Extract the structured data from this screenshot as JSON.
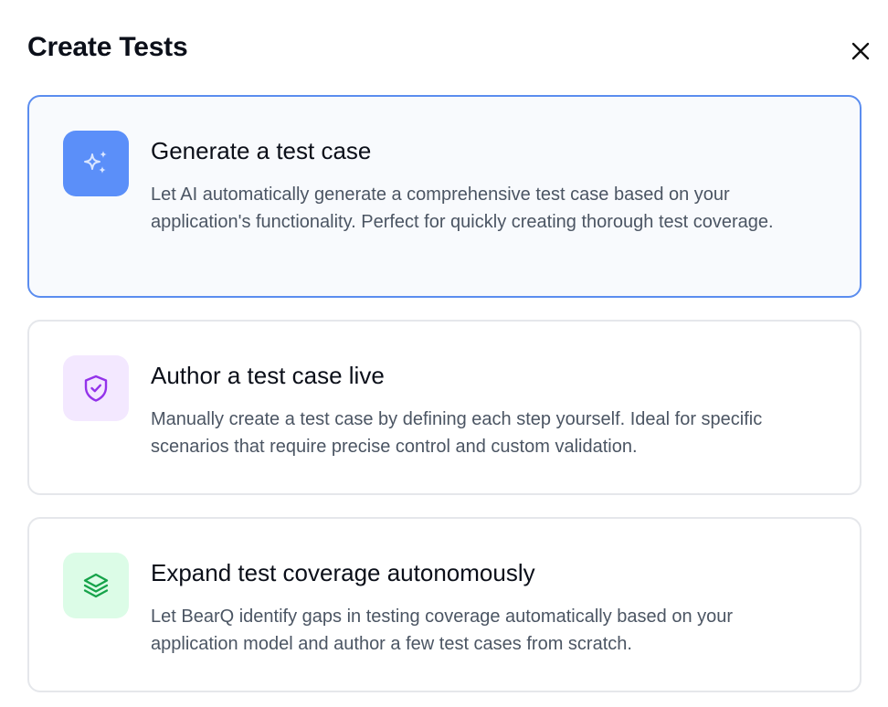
{
  "dialog": {
    "title": "Create Tests"
  },
  "options": [
    {
      "title": "Generate a test case",
      "description": "Let AI automatically generate a comprehensive test case based on your application's functionality. Perfect for quickly creating thorough test coverage.",
      "icon": "sparkles-icon",
      "icon_bg": "#5b8ff9",
      "icon_color": "#dbe7ff",
      "selected": true
    },
    {
      "title": "Author a test case live",
      "description": "Manually create a test case by defining each step yourself. Ideal for specific scenarios that require precise control and custom validation.",
      "icon": "shield-check-icon",
      "icon_bg": "#f3e8ff",
      "icon_color": "#9333ea",
      "selected": false
    },
    {
      "title": "Expand test coverage autonomously",
      "description": "Let BearQ identify gaps in testing coverage automatically based on your application model and author a few test cases from scratch.",
      "icon": "layers-icon",
      "icon_bg": "#dcfce7",
      "icon_color": "#16a34a",
      "selected": false
    }
  ],
  "colors": {
    "selected_border": "#5b8def",
    "card_border": "#e5e7eb"
  }
}
